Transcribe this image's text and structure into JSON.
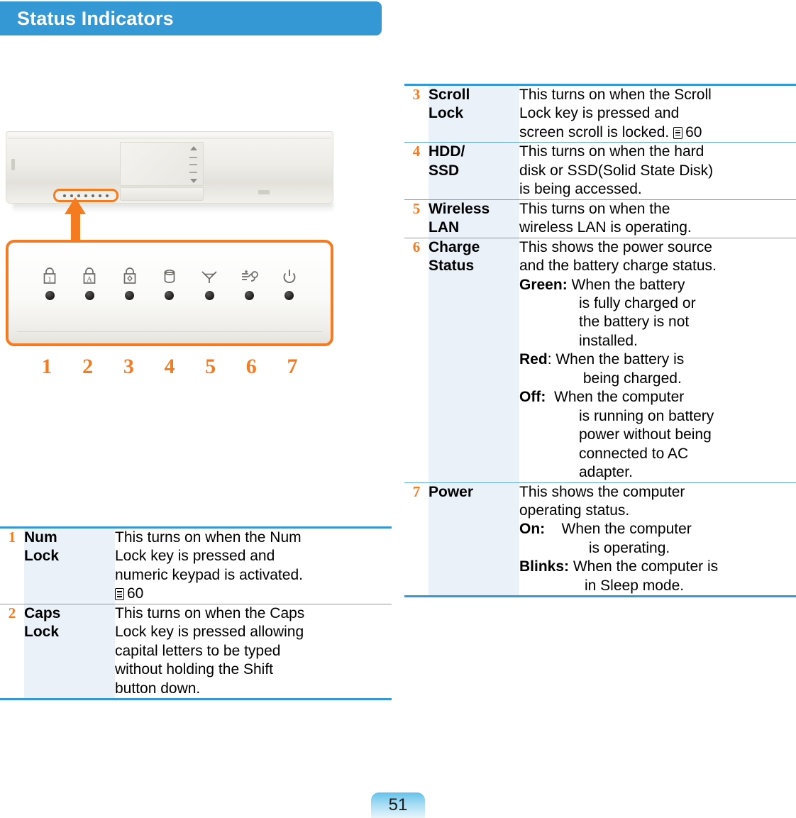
{
  "header": {
    "title": "Status Indicators"
  },
  "illustration": {
    "panel_label": "status-indicator-led-panel",
    "leds": [
      {
        "num": "1",
        "icon": "numlock-padlock-icon",
        "glyph": "1"
      },
      {
        "num": "2",
        "icon": "capslock-padlock-icon",
        "glyph": "A"
      },
      {
        "num": "3",
        "icon": "scrolllock-padlock-icon",
        "glyph": "*"
      },
      {
        "num": "4",
        "icon": "hdd-cylinder-icon",
        "glyph": ""
      },
      {
        "num": "5",
        "icon": "wireless-antenna-icon",
        "glyph": ""
      },
      {
        "num": "6",
        "icon": "charge-plug-icon",
        "glyph": ""
      },
      {
        "num": "7",
        "icon": "power-icon",
        "glyph": ""
      }
    ]
  },
  "table_left": [
    {
      "num": "1",
      "label": "Num\nLock",
      "lines": [
        "This turns on when the Num",
        "Lock key is pressed and",
        "numeric keypad is activated."
      ],
      "ref": "60"
    },
    {
      "num": "2",
      "label": "Caps\nLock",
      "lines": [
        "This turns on when the Caps",
        "Lock key is pressed allowing",
        "capital letters to be typed",
        "without holding the Shift",
        "button down."
      ],
      "ref": ""
    }
  ],
  "table_right": [
    {
      "num": "3",
      "label": "Scroll\nLock",
      "lines": [
        "This turns on when the Scroll",
        "Lock key is pressed and",
        "screen scroll is locked."
      ],
      "ref": "60",
      "ref_inline": true
    },
    {
      "num": "4",
      "label": "HDD/\nSSD",
      "lines": [
        "This turns on when the hard",
        "disk or SSD(Solid State Disk)",
        "is being accessed."
      ],
      "ref": ""
    },
    {
      "num": "5",
      "label": "Wireless\nLAN",
      "lines": [
        "This turns on when the",
        "wireless LAN is operating."
      ],
      "ref": ""
    },
    {
      "num": "6",
      "label": "Charge\nStatus",
      "lines": [
        "This shows the power source",
        "and the battery charge status."
      ],
      "states": [
        {
          "key": "Green:",
          "lines": [
            "When the battery",
            "is fully charged or",
            "the battery is not",
            "installed."
          ]
        },
        {
          "key": "Red",
          "sep": ": ",
          "lines": [
            "When the battery is",
            " being charged."
          ]
        },
        {
          "key": "Off:",
          "lines": [
            "When the computer",
            "is running on battery",
            "power without being",
            "connected to AC",
            "adapter."
          ]
        }
      ],
      "ref": ""
    },
    {
      "num": "7",
      "label": "Power",
      "lines": [
        "This shows the computer",
        "operating status."
      ],
      "states": [
        {
          "key": "On:",
          "lines": [
            "When the computer",
            " is operating."
          ]
        },
        {
          "key": "Blinks:",
          "lines": [
            "When the computer is",
            "in Sleep mode."
          ]
        }
      ],
      "ref": ""
    }
  ],
  "footer": {
    "page_number": "51"
  },
  "colors": {
    "header_blue": "#3498d5",
    "accent_orange": "#f47b20",
    "label_cell_blue": "#eaf1f9",
    "rule_blue": "#5ba7d8"
  }
}
